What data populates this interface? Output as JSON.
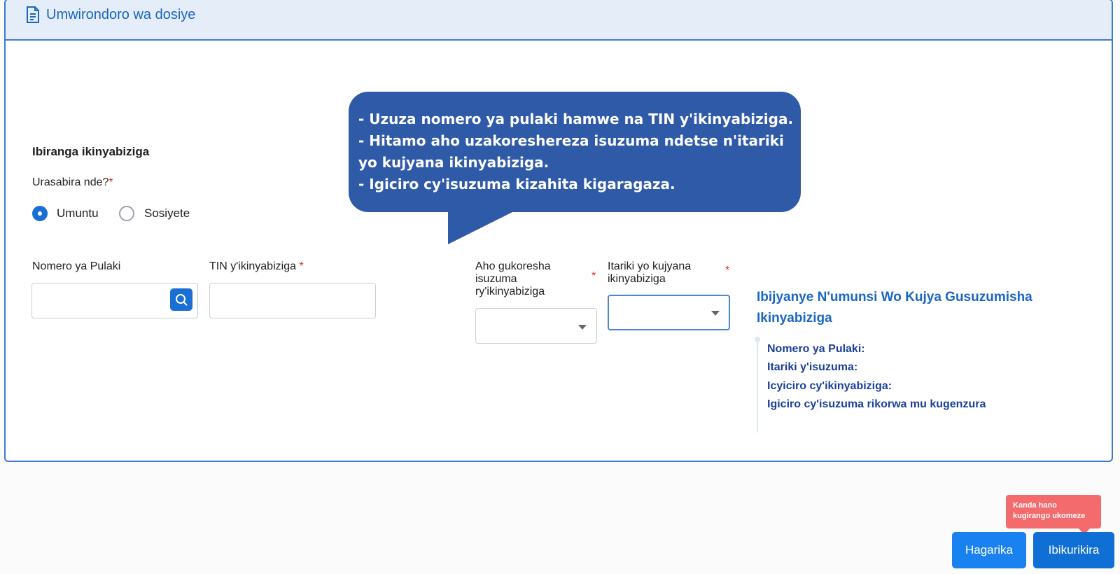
{
  "header": {
    "title": "Umwirondoro wa dosiye",
    "icon": "document-icon"
  },
  "form": {
    "section_title": "Ibiranga ikinyabiziga",
    "question_label": "Urasabira nde?",
    "required_mark": "*",
    "options": [
      {
        "label": "Umuntu",
        "checked": true
      },
      {
        "label": "Sosiyete",
        "checked": false
      }
    ],
    "plate_label": "Nomero ya Pulaki",
    "plate_value": "",
    "tin_label": "TIN y'ikinyabiziga",
    "tin_value": "",
    "location_label_lines": [
      "Aho gukoresha",
      "isuzuma",
      "ry'ikinyabiziga"
    ],
    "location_value": "",
    "date_label_lines": [
      "Itariki yo kujyana",
      "ikinyabiziga"
    ],
    "date_value": ""
  },
  "tooltip": {
    "lines": [
      "- Uzuza nomero ya pulaki hamwe na TIN y'ikinyabiziga.",
      "- Hitamo aho uzakoreshereza isuzuma ndetse n'itariki",
      "yo kujyana ikinyabiziga.",
      "- Igiciro cy'isuzuma kizahita kigaragaza."
    ],
    "color": "#2f5aa8"
  },
  "info_panel": {
    "title_lines": [
      "Ibijyanye N'umunsi Wo Kujya Gusuzumisha",
      "Ikinyabiziga"
    ],
    "items": [
      "Nomero ya Pulaki:",
      "Itariki y'isuzuma:",
      "Icyiciro cy'ikinyabiziga:",
      "Igiciro cy'isuzuma rikorwa mu kugenzura"
    ]
  },
  "actions": {
    "cancel_label": "Hagarika",
    "next_label": "Ibikurikira",
    "hint_lines": [
      "Kanda hano",
      "kugirango ukomeze"
    ],
    "hint_color": "#f46b6d",
    "primary_color": "#0f6fd4"
  }
}
